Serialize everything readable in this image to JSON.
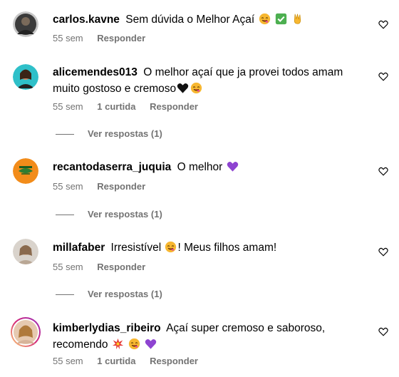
{
  "comments": [
    {
      "username": "carlos.kavne",
      "text": "Sem dúvida o Melhor Açaí",
      "emojis": [
        "smiling-face-icon",
        "check-mark-button-icon",
        "victory-hand-icon"
      ],
      "time": "55 sem",
      "likes": "",
      "reply_label": "Responder"
    },
    {
      "username": "alicemendes013",
      "text": "O melhor açaí que ja provei todos amam muito gostoso e cremoso",
      "emojis": [
        "black-heart-icon",
        "smiling-face-icon"
      ],
      "time": "55 sem",
      "likes": "1 curtida",
      "reply_label": "Responder",
      "view_replies": "Ver respostas (1)"
    },
    {
      "username": "recantodaserra_juquia",
      "text": "O melhor",
      "emojis": [
        "purple-heart-icon"
      ],
      "time": "55 sem",
      "likes": "",
      "reply_label": "Responder",
      "view_replies": "Ver respostas (1)"
    },
    {
      "username": "millafaber",
      "text_before": "Irresistível",
      "text_after": "! Meus filhos amam!",
      "emojis": [
        "smiling-face-icon"
      ],
      "time": "55 sem",
      "likes": "",
      "reply_label": "Responder",
      "view_replies": "Ver respostas (1)"
    },
    {
      "username": "kimberlydias_ribeiro",
      "text": "Açaí super cremoso e saboroso, recomendo",
      "emojis": [
        "collision-icon",
        "smiling-face-icon",
        "purple-heart-icon"
      ],
      "time": "55 sem",
      "likes": "1 curtida",
      "reply_label": "Responder"
    }
  ],
  "colors": {
    "meta_text": "#737373",
    "purple_heart": "#8e44d1",
    "check_green": "#4caf50",
    "emoji_yellow": "#f7b731"
  }
}
